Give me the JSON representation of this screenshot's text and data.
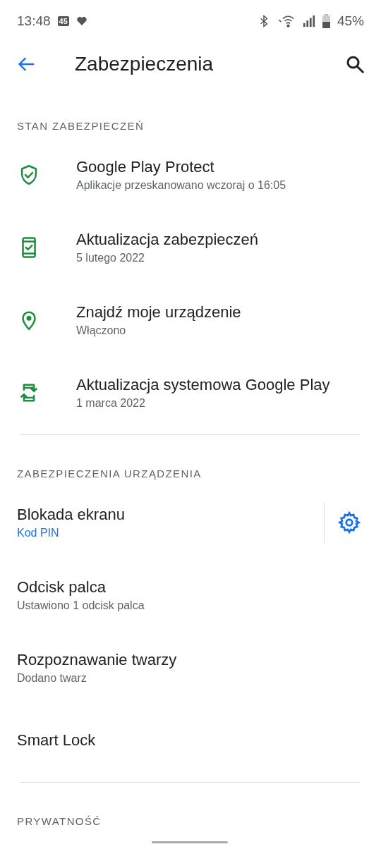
{
  "status_bar": {
    "time": "13:48",
    "notification_badge": "45",
    "battery": "45%"
  },
  "header": {
    "title": "Zabezpieczenia"
  },
  "sections": [
    {
      "title": "STAN ZABEZPIECZEŃ",
      "items": [
        {
          "kind": "icon",
          "title": "Google Play Protect",
          "subtitle": "Aplikacje przeskanowano wczoraj o 16:05"
        },
        {
          "kind": "icon",
          "title": "Aktualizacja zabezpieczeń",
          "subtitle": "5 lutego 2022"
        },
        {
          "kind": "icon",
          "title": "Znajdź moje urządzenie",
          "subtitle": "Włączono"
        },
        {
          "kind": "icon",
          "title": "Aktualizacja systemowa Google Play",
          "subtitle": "1 marca 2022"
        }
      ]
    },
    {
      "title": "ZABEZPIECZENIA URZĄDZENIA",
      "items": [
        {
          "kind": "settings",
          "title": "Blokada ekranu",
          "subtitle": "Kod PIN",
          "accent": true
        },
        {
          "kind": "plain",
          "title": "Odcisk palca",
          "subtitle": "Ustawiono 1 odcisk palca"
        },
        {
          "kind": "plain",
          "title": "Rozpoznawanie twarzy",
          "subtitle": "Dodano twarz"
        },
        {
          "kind": "plain",
          "title": "Smart Lock"
        }
      ]
    },
    {
      "title": "PRYWATNOŚĆ"
    }
  ]
}
